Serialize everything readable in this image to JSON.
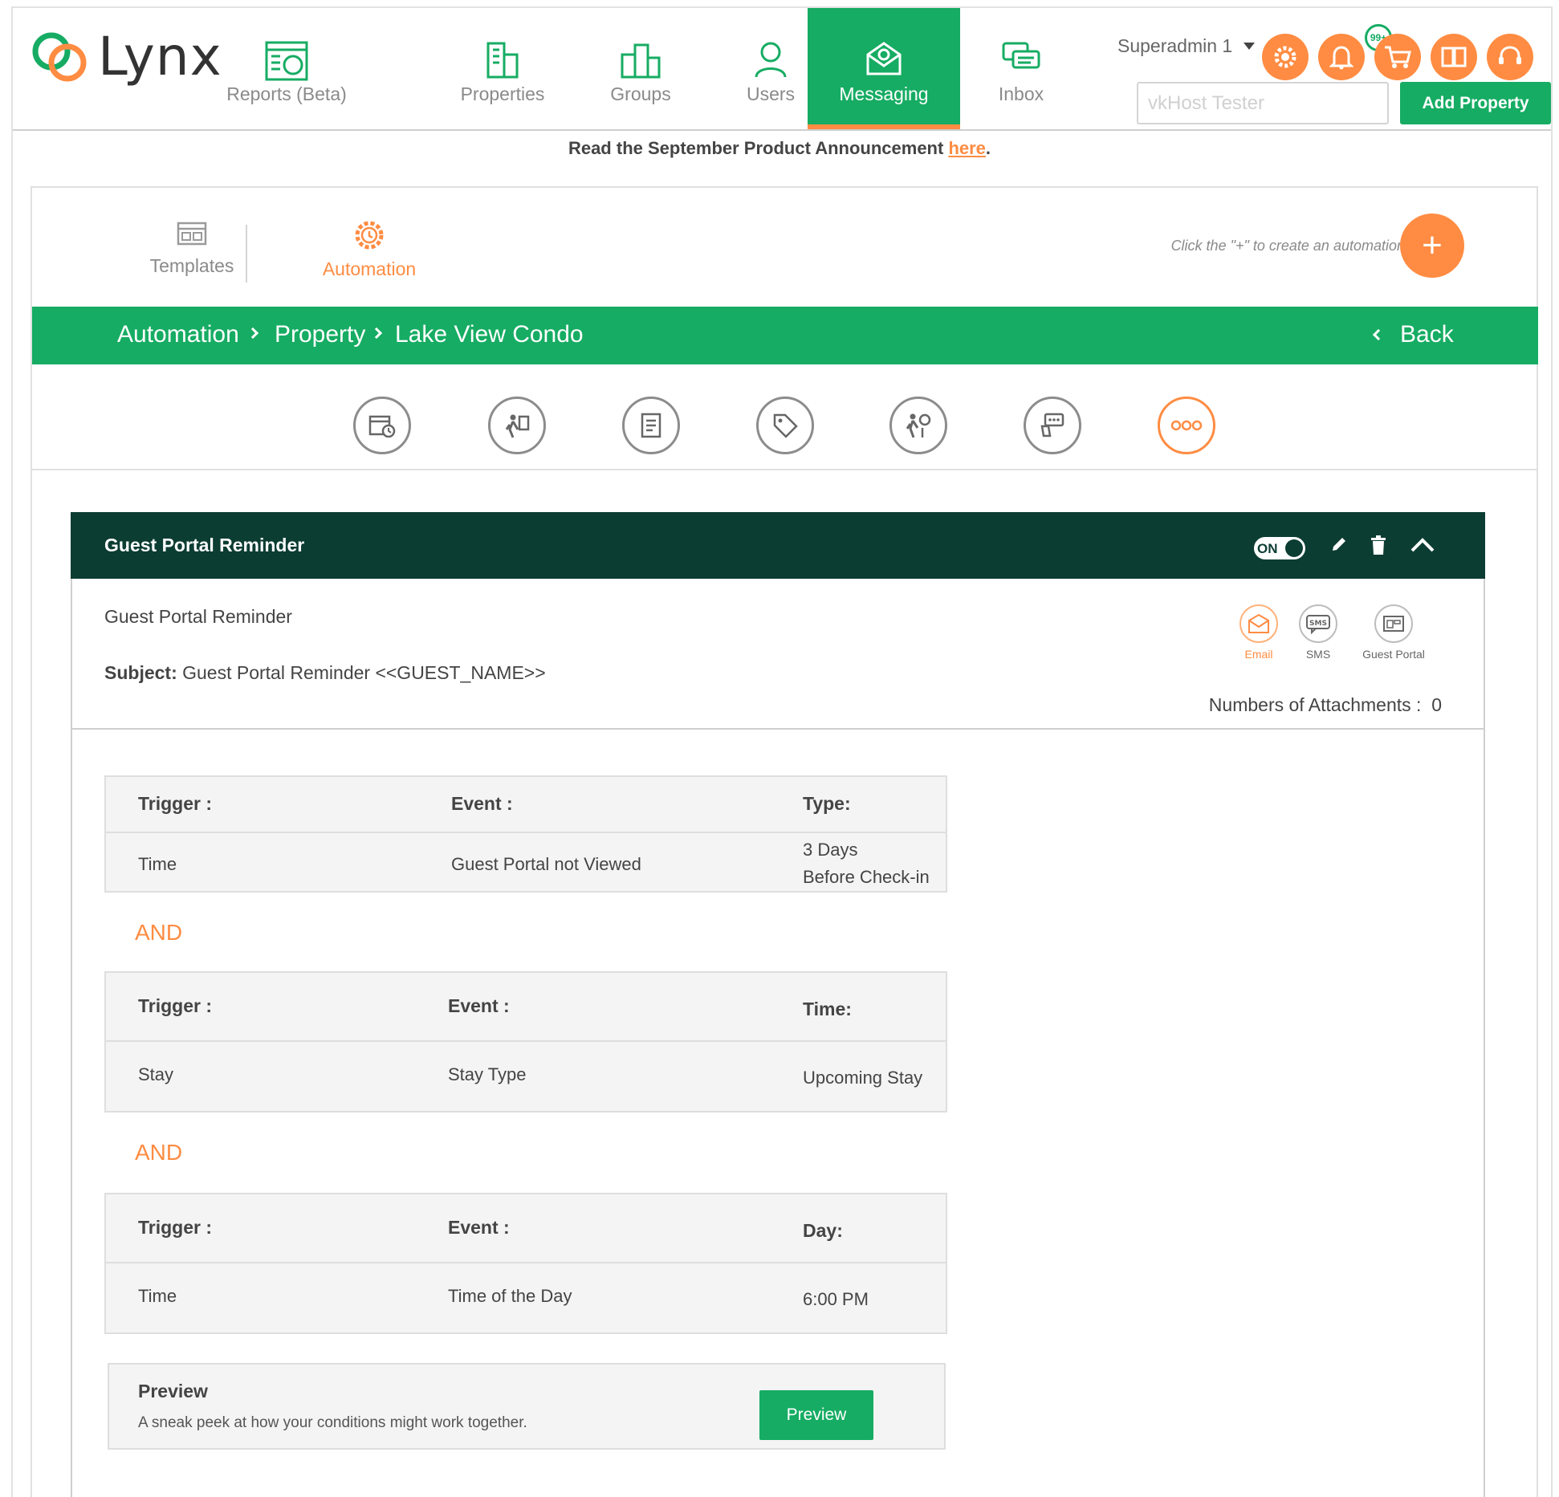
{
  "app": {
    "name": "Lynx"
  },
  "nav": [
    {
      "label": "Reports (Beta)",
      "icon": "reports-icon"
    },
    {
      "label": "Properties",
      "icon": "building-icon"
    },
    {
      "label": "Groups",
      "icon": "groups-icon"
    },
    {
      "label": "Users",
      "icon": "user-icon"
    },
    {
      "label": "Messaging",
      "icon": "messaging-icon",
      "active": true
    },
    {
      "label": "Inbox",
      "icon": "inbox-icon"
    }
  ],
  "user": {
    "name": "Superadmin 1"
  },
  "header_icons": [
    "settings-icon",
    "bell-icon",
    "cart-icon",
    "book-icon",
    "support-icon"
  ],
  "notifications": {
    "badge": "99+"
  },
  "search": {
    "placeholder": "vkHost Tester",
    "value": ""
  },
  "add_property_label": "Add Property",
  "announcement": {
    "text": "Read the September Product Announcement ",
    "link": "here",
    "end": "."
  },
  "tabs": [
    {
      "label": "Templates",
      "active": false
    },
    {
      "label": "Automation",
      "active": true
    }
  ],
  "hint": "Click the \"+\" to create an automation",
  "add_label": "+",
  "breadcrumb": [
    "Automation",
    "Property",
    "Lake View Condo"
  ],
  "back_label": "Back",
  "categories": [
    "calendar-clock-icon",
    "guest-luggage-icon",
    "document-icon",
    "tag-icon",
    "checkout-icon",
    "review-icon",
    "more-icon"
  ],
  "automation": {
    "title": "Guest Portal Reminder",
    "toggle": "ON",
    "name": "Guest Portal Reminder",
    "subject_label": "Subject:",
    "subject_value": "Guest Portal Reminder  <<GUEST_NAME>>",
    "channels": [
      {
        "label": "Email",
        "active": true
      },
      {
        "label": "SMS",
        "active": false
      },
      {
        "label": "Guest Portal",
        "active": false
      }
    ],
    "attachments_label": "Numbers of Attachments :",
    "attachments_count": "0"
  },
  "conditions": [
    {
      "headers": [
        "Trigger :",
        "Event :",
        "Type:"
      ],
      "values": [
        "Time",
        "Guest Portal not Viewed",
        "3 Days",
        "Before Check-in"
      ]
    },
    {
      "headers": [
        "Trigger :",
        "Event :",
        "Time:"
      ],
      "values": [
        "Stay",
        "Stay Type",
        "Upcoming Stay"
      ]
    },
    {
      "headers": [
        "Trigger :",
        "Event :",
        "Day:"
      ],
      "values": [
        "Time",
        "Time of the Day",
        "6:00 PM"
      ]
    }
  ],
  "connector": "AND",
  "preview": {
    "title": "Preview",
    "description": "A sneak peek at how your conditions might work together.",
    "button": "Preview"
  },
  "colors": {
    "brand_green": "#16ac63",
    "accent_orange": "#ff8c42",
    "dark_header": "#0c3d33"
  }
}
